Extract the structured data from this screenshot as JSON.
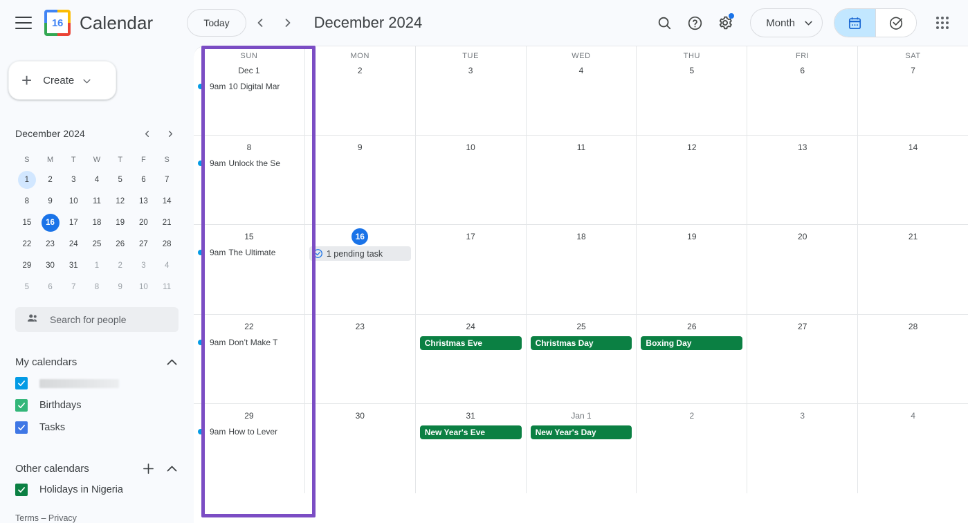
{
  "header": {
    "menu_icon": "hamburger-menu-icon",
    "logo_day": "16",
    "app_title": "Calendar",
    "today_label": "Today",
    "prev_icon": "chevron-left-icon",
    "next_icon": "chevron-right-icon",
    "period_title": "December 2024",
    "search_icon": "search-icon",
    "help_icon": "help-icon",
    "settings_icon": "gear-icon",
    "settings_badge": true,
    "view_label": "Month",
    "view_caret_icon": "chevron-down-icon",
    "toggle": {
      "calendar_icon": "calendar-icon",
      "tasks_icon": "check-circle-icon",
      "active": "calendar"
    },
    "apps_icon": "apps-grid-icon"
  },
  "sidebar": {
    "create": {
      "label": "Create",
      "plus_icon": "plus-icon",
      "caret_icon": "chevron-down-icon"
    },
    "mini_calendar": {
      "title": "December 2024",
      "prev_icon": "chevron-left-icon",
      "next_icon": "chevron-right-icon",
      "dow": [
        "S",
        "M",
        "T",
        "W",
        "T",
        "F",
        "S"
      ],
      "weeks": [
        [
          {
            "d": "1",
            "state": "selected"
          },
          {
            "d": "2"
          },
          {
            "d": "3"
          },
          {
            "d": "4"
          },
          {
            "d": "5"
          },
          {
            "d": "6"
          },
          {
            "d": "7"
          }
        ],
        [
          {
            "d": "8"
          },
          {
            "d": "9"
          },
          {
            "d": "10"
          },
          {
            "d": "11"
          },
          {
            "d": "12"
          },
          {
            "d": "13"
          },
          {
            "d": "14"
          }
        ],
        [
          {
            "d": "15"
          },
          {
            "d": "16",
            "state": "today"
          },
          {
            "d": "17"
          },
          {
            "d": "18"
          },
          {
            "d": "19"
          },
          {
            "d": "20"
          },
          {
            "d": "21"
          }
        ],
        [
          {
            "d": "22"
          },
          {
            "d": "23"
          },
          {
            "d": "24"
          },
          {
            "d": "25"
          },
          {
            "d": "26"
          },
          {
            "d": "27"
          },
          {
            "d": "28"
          }
        ],
        [
          {
            "d": "29"
          },
          {
            "d": "30"
          },
          {
            "d": "31"
          },
          {
            "d": "1",
            "state": "muted"
          },
          {
            "d": "2",
            "state": "muted"
          },
          {
            "d": "3",
            "state": "muted"
          },
          {
            "d": "4",
            "state": "muted"
          }
        ],
        [
          {
            "d": "5",
            "state": "muted"
          },
          {
            "d": "6",
            "state": "muted"
          },
          {
            "d": "7",
            "state": "muted"
          },
          {
            "d": "8",
            "state": "muted"
          },
          {
            "d": "9",
            "state": "muted"
          },
          {
            "d": "10",
            "state": "muted"
          },
          {
            "d": "11",
            "state": "muted"
          }
        ]
      ]
    },
    "search_people": {
      "label": "Search for people",
      "icon": "people-icon"
    },
    "my_calendars": {
      "title": "My calendars",
      "collapse_icon": "chevron-up-icon",
      "items": [
        {
          "label": "",
          "redacted": true,
          "checked": true,
          "color": "#039be5"
        },
        {
          "label": "Birthdays",
          "redacted": false,
          "checked": true,
          "color": "#33b679"
        },
        {
          "label": "Tasks",
          "redacted": false,
          "checked": true,
          "color": "#3f77e5"
        }
      ]
    },
    "other_calendars": {
      "title": "Other calendars",
      "add_icon": "plus-icon",
      "collapse_icon": "chevron-up-icon",
      "items": [
        {
          "label": "Holidays in Nigeria",
          "checked": true,
          "color": "#0b8043"
        }
      ]
    },
    "legal": "Terms – Privacy"
  },
  "grid": {
    "dow_headers": [
      "SUN",
      "MON",
      "TUE",
      "WED",
      "THU",
      "FRI",
      "SAT"
    ],
    "highlight_color": "#7b4dc4",
    "highlighted_column": "SUN",
    "weeks": [
      {
        "show_dow": true,
        "days": [
          {
            "num": "Dec 1",
            "events": [
              {
                "type": "timed",
                "time": "9am",
                "title": "10 Digital Mar",
                "color": "#039be5"
              }
            ]
          },
          {
            "num": "2",
            "events": []
          },
          {
            "num": "3",
            "events": []
          },
          {
            "num": "4",
            "events": []
          },
          {
            "num": "5",
            "events": []
          },
          {
            "num": "6",
            "events": []
          },
          {
            "num": "7",
            "events": []
          }
        ]
      },
      {
        "show_dow": false,
        "days": [
          {
            "num": "8",
            "events": [
              {
                "type": "timed",
                "time": "9am",
                "title": "Unlock the Se",
                "color": "#039be5"
              }
            ]
          },
          {
            "num": "9",
            "events": []
          },
          {
            "num": "10",
            "events": []
          },
          {
            "num": "11",
            "events": []
          },
          {
            "num": "12",
            "events": []
          },
          {
            "num": "13",
            "events": []
          },
          {
            "num": "14",
            "events": []
          }
        ]
      },
      {
        "show_dow": false,
        "days": [
          {
            "num": "15",
            "events": [
              {
                "type": "timed",
                "time": "9am",
                "title": "The Ultimate",
                "color": "#039be5"
              }
            ]
          },
          {
            "num": "16",
            "today": true,
            "events": [
              {
                "type": "task",
                "title": "1 pending task",
                "icon": "check-circle-icon"
              }
            ]
          },
          {
            "num": "17",
            "events": []
          },
          {
            "num": "18",
            "events": []
          },
          {
            "num": "19",
            "events": []
          },
          {
            "num": "20",
            "events": []
          },
          {
            "num": "21",
            "events": []
          }
        ]
      },
      {
        "show_dow": false,
        "days": [
          {
            "num": "22",
            "events": [
              {
                "type": "timed",
                "time": "9am",
                "title": "Don’t Make T",
                "color": "#039be5"
              }
            ]
          },
          {
            "num": "23",
            "events": []
          },
          {
            "num": "24",
            "events": [
              {
                "type": "allday",
                "title": "Christmas Eve",
                "color": "#0b8043"
              }
            ]
          },
          {
            "num": "25",
            "events": [
              {
                "type": "allday",
                "title": "Christmas Day",
                "color": "#0b8043"
              }
            ]
          },
          {
            "num": "26",
            "events": [
              {
                "type": "allday",
                "title": "Boxing Day",
                "color": "#0b8043"
              }
            ]
          },
          {
            "num": "27",
            "events": []
          },
          {
            "num": "28",
            "events": []
          }
        ]
      },
      {
        "show_dow": false,
        "days": [
          {
            "num": "29",
            "events": [
              {
                "type": "timed",
                "time": "9am",
                "title": "How to Lever",
                "color": "#039be5"
              }
            ]
          },
          {
            "num": "30",
            "events": []
          },
          {
            "num": "31",
            "events": [
              {
                "type": "allday",
                "title": "New Year's Eve",
                "color": "#0b8043"
              }
            ]
          },
          {
            "num": "Jan 1",
            "muted": true,
            "events": [
              {
                "type": "allday",
                "title": "New Year's Day",
                "color": "#0b8043"
              }
            ]
          },
          {
            "num": "2",
            "muted": true,
            "events": []
          },
          {
            "num": "3",
            "muted": true,
            "events": []
          },
          {
            "num": "4",
            "muted": true,
            "events": []
          }
        ]
      }
    ]
  }
}
